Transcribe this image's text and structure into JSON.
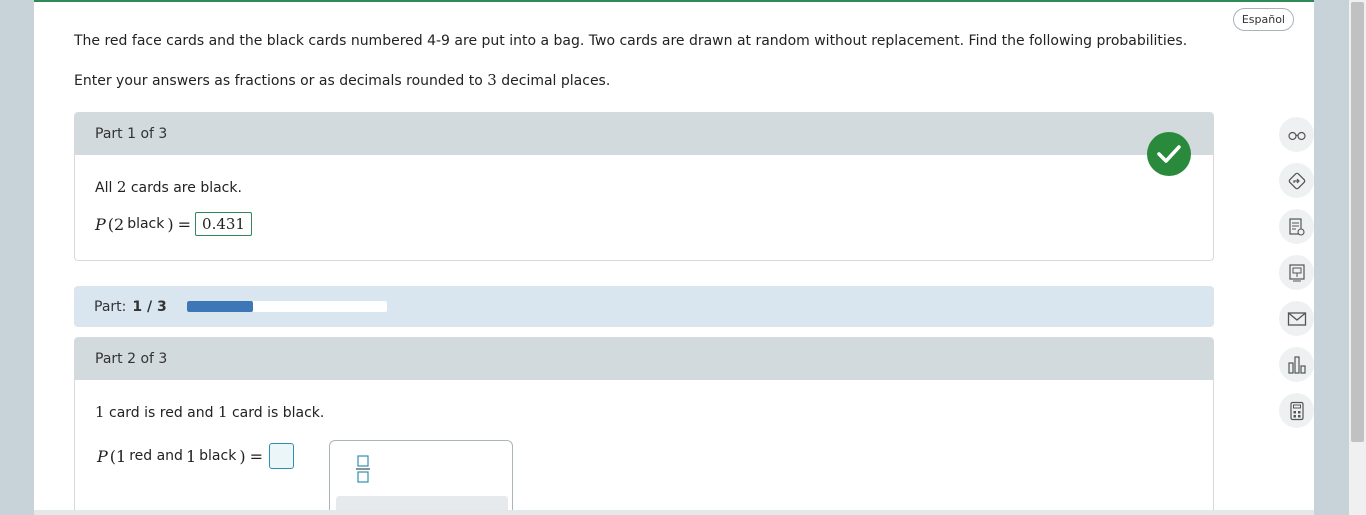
{
  "header": {
    "language_button": "Español"
  },
  "question": {
    "text": "The red face cards and the black cards numbered 4-9 are put into a bag. Two cards are drawn at random without replacement. Find the following probabilities.",
    "instruction_pre": "Enter your answers as fractions or as decimals rounded to",
    "instruction_num": "3",
    "instruction_post": "decimal places."
  },
  "part1": {
    "header": "Part 1 of 3",
    "statement_pre": "All",
    "statement_num": "2",
    "statement_post": "cards are black.",
    "eq_p": "P",
    "eq_open": "(",
    "eq_num": "2",
    "eq_word": "black",
    "eq_close": ")",
    "eq_equals": "=",
    "answer": "0.431",
    "status": "correct"
  },
  "progress": {
    "label": "Part:",
    "value": "1 / 3",
    "fraction": 0.333
  },
  "part2": {
    "header": "Part 2 of 3",
    "statement_num1": "1",
    "statement_mid": "card is red and",
    "statement_num2": "1",
    "statement_post": "card is black.",
    "eq_p": "P",
    "eq_open": "(",
    "eq_num1": "1",
    "eq_word1": "red and",
    "eq_num2": "1",
    "eq_word2": "black",
    "eq_close": ")",
    "eq_equals": "=",
    "answer": ""
  },
  "tools": [
    {
      "icon": "glasses-icon"
    },
    {
      "icon": "hint-arrow-icon"
    },
    {
      "icon": "notes-icon"
    },
    {
      "icon": "textbook-icon"
    },
    {
      "icon": "mail-icon"
    },
    {
      "icon": "chart-icon"
    },
    {
      "icon": "calculator-icon"
    }
  ],
  "colors": {
    "accent_green": "#2a8a3c",
    "progress_fill": "#3e77b5",
    "header_gray": "#d2dade"
  }
}
